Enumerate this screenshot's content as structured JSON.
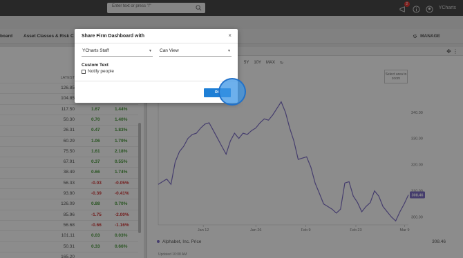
{
  "topbar": {
    "search_placeholder": "Enter text or press \"/\"",
    "notification_count": "2",
    "username": "YCharts"
  },
  "tabs": [
    {
      "label": "board"
    },
    {
      "label": "Asset Classes & Risk"
    },
    {
      "label": "C"
    }
  ],
  "manage_label": "MANAGE",
  "table": {
    "header_latest": "LATEST",
    "rows": [
      {
        "latest": "126.85",
        "chg": "",
        "pct": ""
      },
      {
        "latest": "104.85",
        "chg": "",
        "pct": ""
      },
      {
        "latest": "117.50",
        "chg": "1.67",
        "pct": "1.44%"
      },
      {
        "latest": "50.30",
        "chg": "0.70",
        "pct": "1.40%"
      },
      {
        "latest": "26.31",
        "chg": "0.47",
        "pct": "1.83%"
      },
      {
        "latest": "60.29",
        "chg": "1.06",
        "pct": "1.79%"
      },
      {
        "latest": "75.50",
        "chg": "1.61",
        "pct": "2.18%"
      },
      {
        "latest": "67.91",
        "chg": "0.37",
        "pct": "0.55%"
      },
      {
        "latest": "38.49",
        "chg": "0.66",
        "pct": "1.74%"
      },
      {
        "latest": "56.33",
        "chg": "-0.03",
        "pct": "-0.05%"
      },
      {
        "latest": "93.80",
        "chg": "-0.39",
        "pct": "-0.41%"
      },
      {
        "latest": "126.09",
        "chg": "0.88",
        "pct": "0.70%"
      },
      {
        "latest": "85.96",
        "chg": "-1.75",
        "pct": "-2.00%"
      },
      {
        "latest": "56.68",
        "chg": "-0.66",
        "pct": "-1.16%"
      },
      {
        "latest": "101.11",
        "chg": "0.03",
        "pct": "0.03%"
      },
      {
        "latest": "50.31",
        "chg": "0.33",
        "pct": "0.66%"
      },
      {
        "latest": "165.20",
        "chg": "",
        "pct": ""
      }
    ]
  },
  "chart_panel": {
    "ranges": [
      "5Y",
      "10Y",
      "MAX"
    ],
    "zoom_hint": "Select area to zoom",
    "legend_name": "Alphabet, Inc. Price",
    "legend_value": "308.46",
    "updated": "Updated 10:08 AM"
  },
  "chart_data": {
    "type": "line",
    "x_ticks": [
      "Jan 12",
      "Jan 26",
      "Feb 9",
      "Feb 23",
      "Mar 9"
    ],
    "y_ticks": [
      300,
      310,
      320,
      330,
      340
    ],
    "ylim": [
      297,
      346
    ],
    "last_value_label": "308.46",
    "series": [
      {
        "name": "Alphabet, Inc. Price",
        "color": "#7e6fc7",
        "values": [
          312.5,
          313.5,
          314.5,
          312.5,
          321,
          325,
          327,
          330,
          331.5,
          332,
          334,
          335.5,
          336,
          333,
          330,
          327,
          324,
          329,
          332,
          330,
          332,
          331.5,
          333,
          334,
          336,
          337.5,
          337,
          339,
          341.5,
          344,
          340,
          334,
          329,
          322,
          322.5,
          323,
          319,
          313,
          309,
          305,
          304,
          303,
          301.5,
          303,
          313,
          313.5,
          308,
          305.5,
          302,
          304,
          305.5,
          310,
          308,
          304,
          302,
          300,
          298.5,
          302,
          305,
          308.46
        ]
      }
    ]
  },
  "modal": {
    "title": "Share Firm Dashboard with",
    "close": "×",
    "select_group": "YCharts Staff",
    "select_permission": "Can View",
    "custom_text_label": "Custom Text",
    "notify_label": "Notify people",
    "ok_label": "OK"
  }
}
